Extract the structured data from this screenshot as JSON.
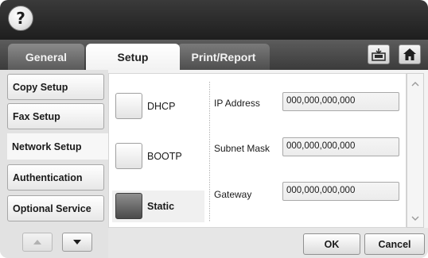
{
  "header": {
    "help_symbol": "?",
    "help_icon": "question-circle-icon"
  },
  "tabs": [
    {
      "label": "General",
      "active": false
    },
    {
      "label": "Setup",
      "active": true
    },
    {
      "label": "Print/Report",
      "active": false
    }
  ],
  "tab_actions": [
    {
      "icon": "save-to-tray-icon"
    },
    {
      "icon": "home-icon"
    }
  ],
  "sidebar": {
    "items": [
      {
        "label": "Copy Setup",
        "active": false
      },
      {
        "label": "Fax Setup",
        "active": false
      },
      {
        "label": "Network Setup",
        "active": true
      },
      {
        "label": "Authentication",
        "active": false
      },
      {
        "label": "Optional Service",
        "active": false
      }
    ],
    "scroll_up_icon": "triangle-up-icon",
    "scroll_down_icon": "triangle-down-icon"
  },
  "ip_options": [
    {
      "label": "DHCP",
      "selected": false
    },
    {
      "label": "BOOTP",
      "selected": false
    },
    {
      "label": "Static",
      "selected": true
    }
  ],
  "fields": [
    {
      "label": "IP Address",
      "value": "000,000,000,000"
    },
    {
      "label": "Subnet Mask",
      "value": "000,000,000,000"
    },
    {
      "label": "Gateway",
      "value": "000,000,000,000"
    }
  ],
  "scrollbar": {
    "up_icon": "chevron-up-icon",
    "down_icon": "chevron-down-icon"
  },
  "actions": {
    "ok_label": "OK",
    "cancel_label": "Cancel"
  },
  "colors": {
    "header_bg": "#2a2a2a",
    "tab_active_bg": "#ffffff",
    "selected_option": "#5a5a5a"
  }
}
